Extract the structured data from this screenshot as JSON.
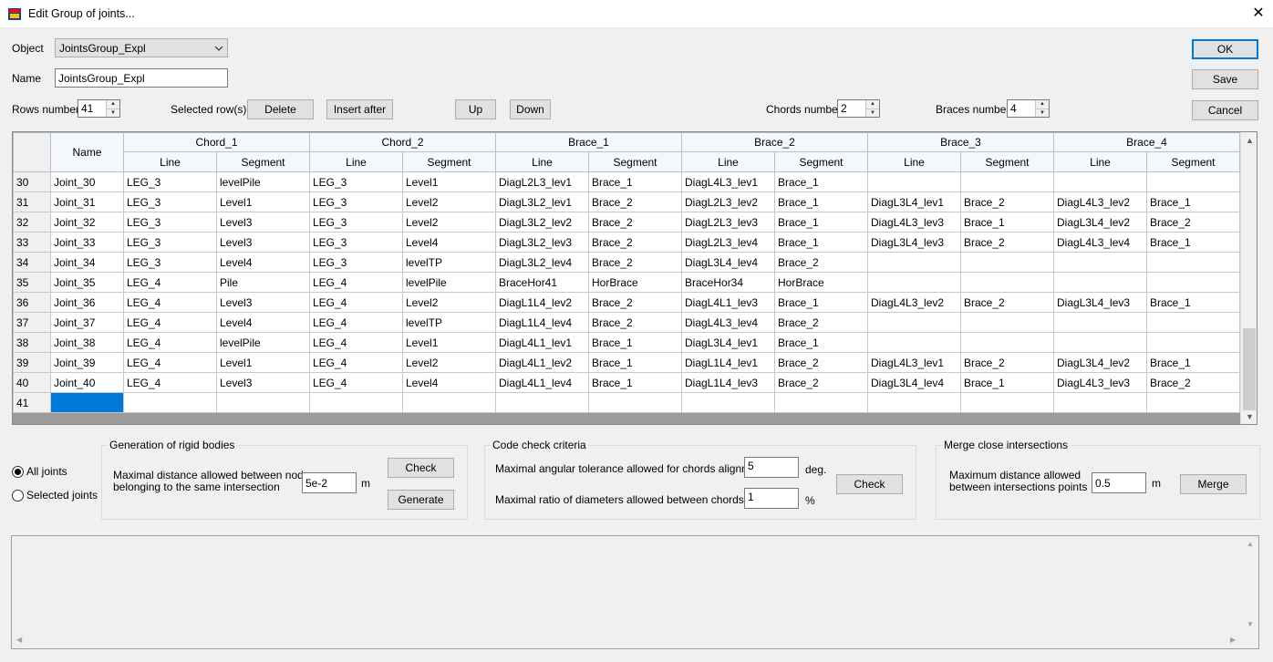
{
  "window": {
    "title": "Edit Group of joints...",
    "close_glyph": "✕",
    "app_icon": "app-icon"
  },
  "form": {
    "object_label": "Object",
    "object_value": "JointsGroup_Expl",
    "name_label": "Name",
    "name_value": "JointsGroup_Expl",
    "rows_label": "Rows number",
    "rows_value": "41",
    "selected_rows_label": "Selected row(s) :",
    "chords_label": "Chords number",
    "chords_value": "2",
    "braces_label": "Braces number",
    "braces_value": "4"
  },
  "buttons": {
    "ok": "OK",
    "save": "Save",
    "cancel": "Cancel",
    "delete": "Delete",
    "insert_after": "Insert after",
    "up": "Up",
    "down": "Down"
  },
  "grid": {
    "name_header": "Name",
    "groups": [
      "Chord_1",
      "Chord_2",
      "Brace_1",
      "Brace_2",
      "Brace_3",
      "Brace_4"
    ],
    "sub_headers": [
      "Line",
      "Segment"
    ],
    "rows": [
      [
        "30",
        "Joint_30",
        "LEG_3",
        "levelPile",
        "LEG_3",
        "Level1",
        "DiagL2L3_lev1",
        "Brace_1",
        "DiagL4L3_lev1",
        "Brace_1",
        "",
        "",
        "",
        ""
      ],
      [
        "31",
        "Joint_31",
        "LEG_3",
        "Level1",
        "LEG_3",
        "Level2",
        "DiagL3L2_lev1",
        "Brace_2",
        "DiagL2L3_lev2",
        "Brace_1",
        "DiagL3L4_lev1",
        "Brace_2",
        "DiagL4L3_lev2",
        "Brace_1"
      ],
      [
        "32",
        "Joint_32",
        "LEG_3",
        "Level3",
        "LEG_3",
        "Level2",
        "DiagL3L2_lev2",
        "Brace_2",
        "DiagL2L3_lev3",
        "Brace_1",
        "DiagL4L3_lev3",
        "Brace_1",
        "DiagL3L4_lev2",
        "Brace_2"
      ],
      [
        "33",
        "Joint_33",
        "LEG_3",
        "Level3",
        "LEG_3",
        "Level4",
        "DiagL3L2_lev3",
        "Brace_2",
        "DiagL2L3_lev4",
        "Brace_1",
        "DiagL3L4_lev3",
        "Brace_2",
        "DiagL4L3_lev4",
        "Brace_1"
      ],
      [
        "34",
        "Joint_34",
        "LEG_3",
        "Level4",
        "LEG_3",
        "levelTP",
        "DiagL3L2_lev4",
        "Brace_2",
        "DiagL3L4_lev4",
        "Brace_2",
        "",
        "",
        "",
        ""
      ],
      [
        "35",
        "Joint_35",
        "LEG_4",
        "Pile",
        "LEG_4",
        "levelPile",
        "BraceHor41",
        "HorBrace",
        "BraceHor34",
        "HorBrace",
        "",
        "",
        "",
        ""
      ],
      [
        "36",
        "Joint_36",
        "LEG_4",
        "Level3",
        "LEG_4",
        "Level2",
        "DiagL1L4_lev2",
        "Brace_2",
        "DiagL4L1_lev3",
        "Brace_1",
        "DiagL4L3_lev2",
        "Brace_2",
        "DiagL3L4_lev3",
        "Brace_1"
      ],
      [
        "37",
        "Joint_37",
        "LEG_4",
        "Level4",
        "LEG_4",
        "levelTP",
        "DiagL1L4_lev4",
        "Brace_2",
        "DiagL4L3_lev4",
        "Brace_2",
        "",
        "",
        "",
        ""
      ],
      [
        "38",
        "Joint_38",
        "LEG_4",
        "levelPile",
        "LEG_4",
        "Level1",
        "DiagL4L1_lev1",
        "Brace_1",
        "DiagL3L4_lev1",
        "Brace_1",
        "",
        "",
        "",
        ""
      ],
      [
        "39",
        "Joint_39",
        "LEG_4",
        "Level1",
        "LEG_4",
        "Level2",
        "DiagL4L1_lev2",
        "Brace_1",
        "DiagL1L4_lev1",
        "Brace_2",
        "DiagL4L3_lev1",
        "Brace_2",
        "DiagL3L4_lev2",
        "Brace_1"
      ],
      [
        "40",
        "Joint_40",
        "LEG_4",
        "Level3",
        "LEG_4",
        "Level4",
        "DiagL4L1_lev4",
        "Brace_1",
        "DiagL1L4_lev3",
        "Brace_2",
        "DiagL3L4_lev4",
        "Brace_1",
        "DiagL4L3_lev3",
        "Brace_2"
      ],
      [
        "41",
        "",
        "",
        "",
        "",
        "",
        "",
        "",
        "",
        "",
        "",
        "",
        "",
        ""
      ]
    ]
  },
  "scope": {
    "all_joints": "All joints",
    "selected_joints": "Selected joints",
    "selected": "all"
  },
  "rigid": {
    "caption": "Generation of rigid bodies",
    "desc_line1": "Maximal distance allowed between nodes",
    "desc_line2": "belonging to the same intersection",
    "value": "5e-2",
    "unit": "m",
    "check": "Check",
    "generate": "Generate"
  },
  "codecheck": {
    "caption": "Code check criteria",
    "angle_label": "Maximal angular tolerance allowed for chords alignment",
    "angle_value": "5",
    "angle_unit": "deg.",
    "ratio_label": "Maximal ratio of diameters allowed between chords",
    "ratio_value": "1",
    "ratio_unit": "%",
    "check": "Check"
  },
  "merge": {
    "caption": "Merge close intersections",
    "desc_line1": "Maximum distance allowed",
    "desc_line2": "between intersections points",
    "value": "0.5",
    "unit": "m",
    "merge": "Merge"
  },
  "colors": {
    "selection": "#0078d7",
    "header_bg": "#f4f7fc",
    "window_bg": "#f0f0f0"
  },
  "icons": {
    "combo": "chevron-down-icon",
    "spin_up": "spin-up-icon",
    "spin_down": "spin-down-icon"
  }
}
